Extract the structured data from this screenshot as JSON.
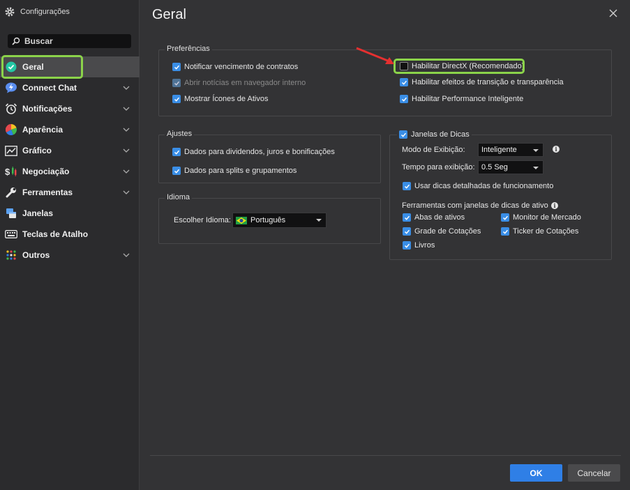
{
  "window": {
    "title": "Configurações"
  },
  "search": {
    "placeholder": "Buscar"
  },
  "sidebar": {
    "items": [
      {
        "label": "Geral",
        "icon": "check-circle-icon"
      },
      {
        "label": "Connect Chat",
        "icon": "chat-icon"
      },
      {
        "label": "Notificações",
        "icon": "alarm-clock-icon"
      },
      {
        "label": "Aparência",
        "icon": "color-wheel-icon"
      },
      {
        "label": "Gráfico",
        "icon": "chart-icon"
      },
      {
        "label": "Negociação",
        "icon": "dollar-candles-icon"
      },
      {
        "label": "Ferramentas",
        "icon": "wrench-icon"
      },
      {
        "label": "Janelas",
        "icon": "windows-icon"
      },
      {
        "label": "Teclas de Atalho",
        "icon": "keyboard-icon"
      },
      {
        "label": "Outros",
        "icon": "dots-grid-icon"
      }
    ]
  },
  "main": {
    "title": "Geral",
    "preferencias": {
      "legend": "Preferências",
      "left": [
        {
          "label": "Notificar vencimento de contratos",
          "checked": true
        },
        {
          "label": "Abrir notícias em navegador interno",
          "checked": true,
          "disabled": true
        },
        {
          "label": "Mostrar Ícones de Ativos",
          "checked": true
        }
      ],
      "right": [
        {
          "label": "Habilitar DirectX (Recomendado)",
          "checked": false
        },
        {
          "label": "Habilitar efeitos de transição e transparência",
          "checked": true
        },
        {
          "label": "Habilitar Performance Inteligente",
          "checked": true
        }
      ]
    },
    "ajustes": {
      "legend": "Ajustes",
      "items": [
        {
          "label": "Dados para dividendos, juros e bonificações",
          "checked": true
        },
        {
          "label": "Dados para splits e grupamentos",
          "checked": true
        }
      ]
    },
    "idioma": {
      "legend": "Idioma",
      "label": "Escolher Idioma:",
      "value": "Português"
    },
    "dicas": {
      "legend": "Janelas de Dicas",
      "modo_label": "Modo de Exibição:",
      "modo_value": "Inteligente",
      "tempo_label": "Tempo para exibição:",
      "tempo_value": "0.5 Seg",
      "detalhadas": "Usar dicas detalhadas de funcionamento",
      "ferramentas_label": "Ferramentas com janelas de dicas de ativo",
      "tools": [
        "Abas de ativos",
        "Monitor de Mercado",
        "Grade de Cotações",
        "Ticker de Cotações",
        "Livros"
      ]
    }
  },
  "footer": {
    "ok": "OK",
    "cancel": "Cancelar"
  },
  "colors": {
    "accent": "#2f7fe6",
    "highlight": "#8bd34a",
    "annotation_arrow": "#e53030"
  }
}
